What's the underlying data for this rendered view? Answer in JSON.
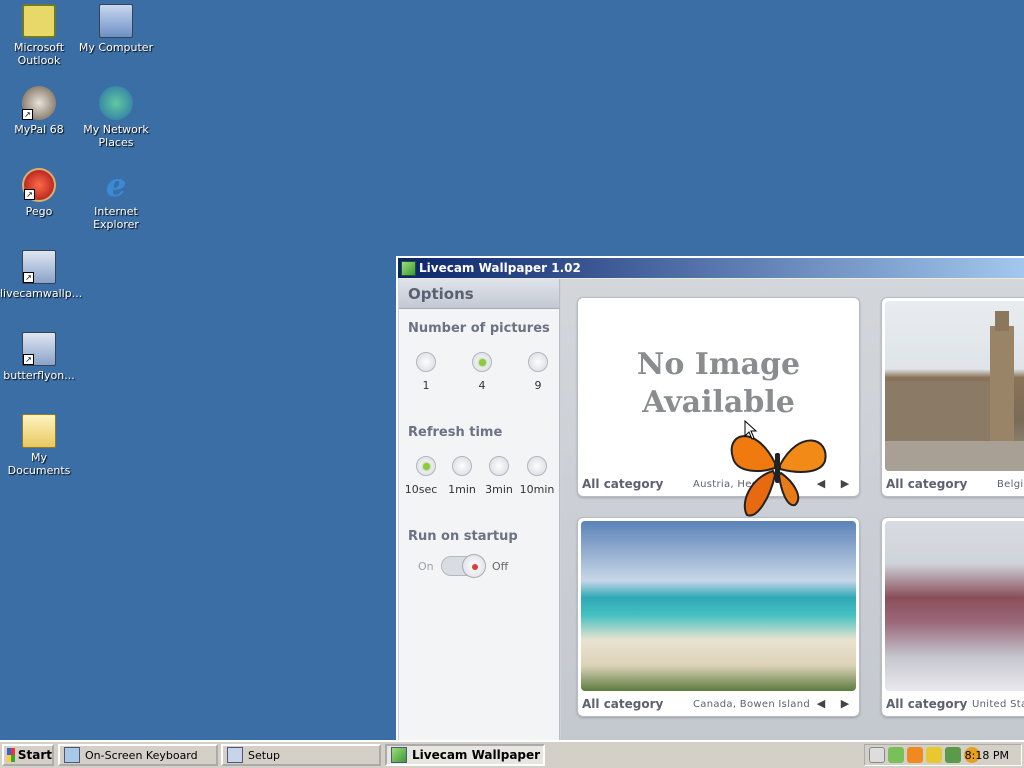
{
  "desktop": {
    "icons": [
      {
        "label": "Microsoft\nOutlook",
        "icon": "outlook-icon"
      },
      {
        "label": "My Computer",
        "icon": "computer-icon"
      },
      {
        "label": "MyPal 68",
        "icon": "mypal-icon"
      },
      {
        "label": "My Network\nPlaces",
        "icon": "network-icon"
      },
      {
        "label": "Pego",
        "icon": "pego-icon"
      },
      {
        "label": "Internet\nExplorer",
        "icon": "ie-icon"
      },
      {
        "label": "livecamwallp...",
        "icon": "installer-icon"
      },
      {
        "label": "butterflyon...",
        "icon": "installer-icon"
      },
      {
        "label": "My Documents",
        "icon": "documents-icon"
      }
    ]
  },
  "window": {
    "title": "Livecam Wallpaper 1.02",
    "options": {
      "header": "Options",
      "num_pictures": {
        "label": "Number of pictures",
        "choices": [
          "1",
          "4",
          "9"
        ],
        "selected": "4"
      },
      "refresh": {
        "label": "Refresh time",
        "choices": [
          "10sec",
          "1min",
          "3min",
          "10min"
        ],
        "selected": "10sec"
      },
      "startup": {
        "label": "Run on startup",
        "on": "On",
        "off": "Off",
        "state": "Off"
      }
    },
    "cards": [
      {
        "image": "No Image\nAvailable",
        "category": "All category",
        "location": "Austria, Heck"
      },
      {
        "image": "",
        "category": "All category",
        "location": "Belgium"
      },
      {
        "image": "",
        "category": "All category",
        "location": "Canada, Bowen Island"
      },
      {
        "image": "",
        "category": "All category",
        "location": "United States"
      }
    ]
  },
  "taskbar": {
    "start": "Start",
    "tasks": [
      "On-Screen Keyboard",
      "Setup",
      "Livecam Wallpaper"
    ],
    "active": "Livecam Wallpaper",
    "clock": "8:18 PM"
  }
}
